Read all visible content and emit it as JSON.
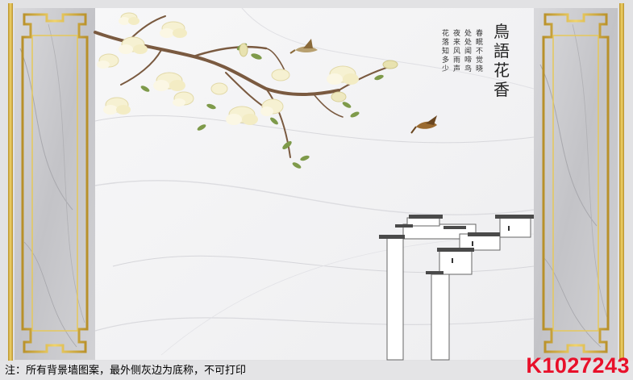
{
  "artwork": {
    "calligraphy_title": "鳥語花香",
    "poem_lines": [
      "春眠不觉晓",
      "处处闻啼鸟",
      "夜来风雨声",
      "花落知多少"
    ],
    "colors": {
      "gold_frame": "#d8b33c",
      "marble_panel": "#c8c8cc",
      "white_marble": "#f4f4f6",
      "blossom": "#f6f1d2",
      "branch": "#7a5a40",
      "leaf": "#7e9a4a",
      "bird": "#9a6a30",
      "roof": "#4a4a4a"
    }
  },
  "footer": {
    "note": "注：所有背景墙图案，最外侧灰边为底称，不可打印",
    "product_code": "K1027243"
  }
}
